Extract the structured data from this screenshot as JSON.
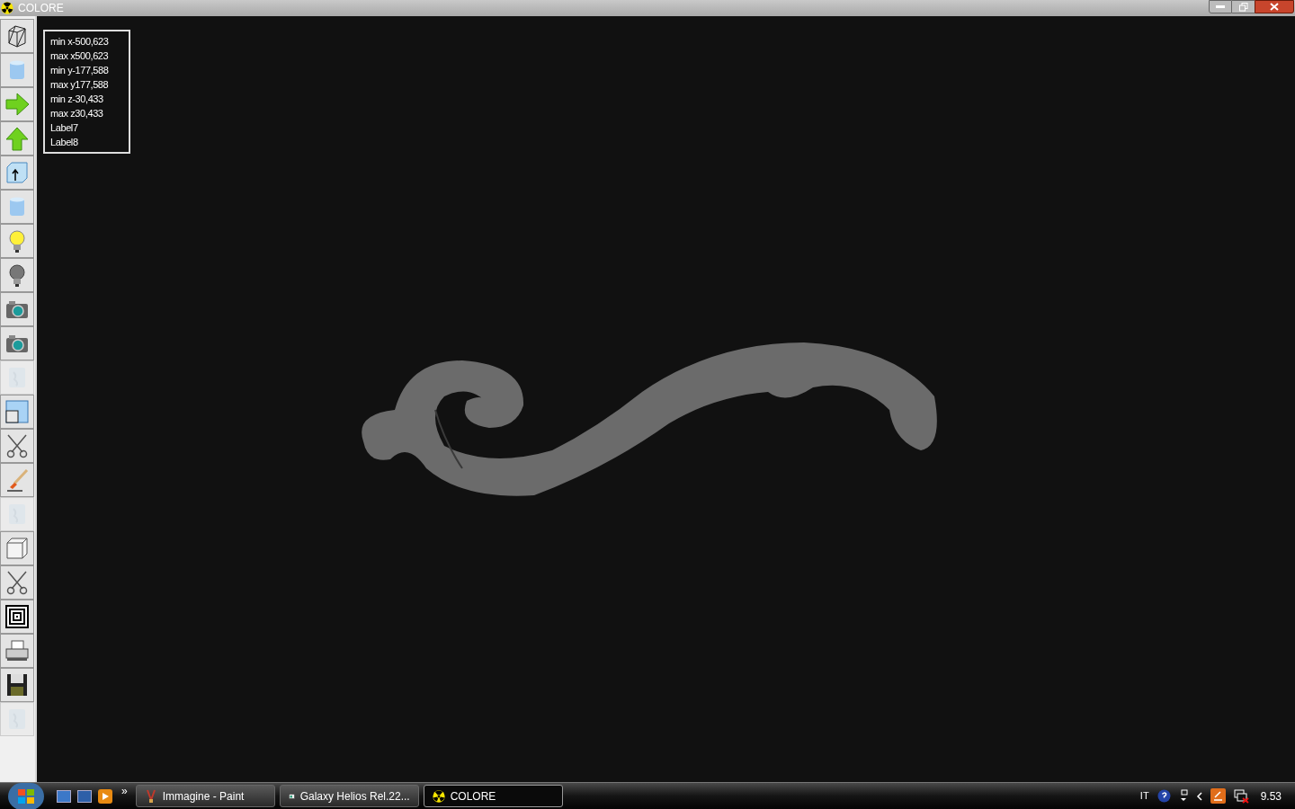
{
  "window": {
    "title": "COLORE"
  },
  "toolbar": [
    {
      "kind": "wireframe",
      "disabled": false
    },
    {
      "kind": "cylinder",
      "disabled": false
    },
    {
      "kind": "arrow-right",
      "disabled": false
    },
    {
      "kind": "arrow-up",
      "disabled": false
    },
    {
      "kind": "box-arrow",
      "disabled": false
    },
    {
      "kind": "cylinder",
      "disabled": false
    },
    {
      "kind": "bulb-on",
      "disabled": false
    },
    {
      "kind": "bulb-off",
      "disabled": false
    },
    {
      "kind": "camera",
      "disabled": false
    },
    {
      "kind": "camera",
      "disabled": false
    },
    {
      "kind": "texture",
      "disabled": true
    },
    {
      "kind": "window",
      "disabled": false
    },
    {
      "kind": "scissors",
      "disabled": false
    },
    {
      "kind": "brush",
      "disabled": false
    },
    {
      "kind": "texture",
      "disabled": true
    },
    {
      "kind": "cube",
      "disabled": false
    },
    {
      "kind": "scissors",
      "disabled": false
    },
    {
      "kind": "frame",
      "disabled": false
    },
    {
      "kind": "printer",
      "disabled": false
    },
    {
      "kind": "floppy",
      "disabled": false
    },
    {
      "kind": "texture",
      "disabled": true
    }
  ],
  "info_labels": [
    "min x-500,623",
    "max x500,623",
    "min y-177,588",
    "max y177,588",
    "min z-30,433",
    "max z30,433",
    "Label7",
    "Label8"
  ],
  "taskbar": {
    "overflow": "»",
    "tasks": [
      {
        "label": "Immagine - Paint",
        "kind": "paint",
        "selected": false
      },
      {
        "label": "Galaxy Helios  Rel.22...",
        "kind": "app",
        "selected": false
      },
      {
        "label": "COLORE",
        "kind": "radiation",
        "selected": true
      }
    ],
    "language": "IT",
    "clock": "9.53"
  }
}
